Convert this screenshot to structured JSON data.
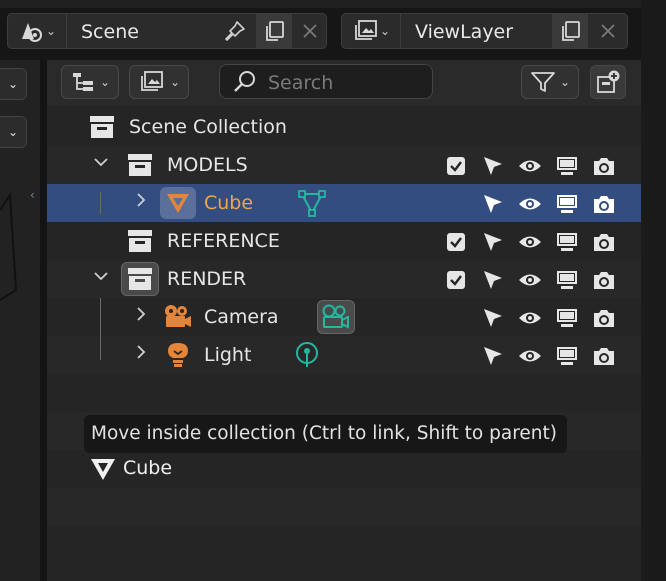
{
  "topbar": {
    "scene": {
      "label": "Scene",
      "pin_icon": "pin-icon",
      "new_icon": "duplicate-icon",
      "close_icon": "close-icon"
    },
    "view_layer": {
      "label": "ViewLayer",
      "new_icon": "duplicate-icon",
      "close_icon": "close-icon"
    }
  },
  "outliner": {
    "header": {
      "display_mode_icon": "outliner-display-mode-icon",
      "filter_icon": "filter-icon",
      "search_placeholder": "Search",
      "new_collection_icon": "new-collection-icon"
    },
    "scene_collection_label": "Scene Collection",
    "rows": [
      {
        "name": "MODELS",
        "type": "collection",
        "expanded": true,
        "checked": true
      },
      {
        "name": "Cube",
        "type": "mesh",
        "selected": true,
        "data_icon": "mesh-data-icon"
      },
      {
        "name": "REFERENCE",
        "type": "collection",
        "checked": true
      },
      {
        "name": "RENDER",
        "type": "collection",
        "expanded": true,
        "checked": true,
        "active": true
      },
      {
        "name": "Camera",
        "type": "camera",
        "data_icon": "camera-data-icon"
      },
      {
        "name": "Light",
        "type": "light",
        "data_icon": "light-data-icon"
      }
    ],
    "restriction_icons": [
      "select-icon",
      "eye-icon",
      "monitor-icon",
      "camera-render-icon"
    ]
  },
  "tooltip": {
    "text": "Move inside collection (Ctrl to link, Shift to parent)"
  },
  "drag_item": {
    "label": "Cube",
    "icon": "mesh-icon"
  },
  "colors": {
    "selection": "#334d80",
    "object_orange": "#e5853a",
    "data_teal": "#25b8a0",
    "background": "#252525"
  }
}
